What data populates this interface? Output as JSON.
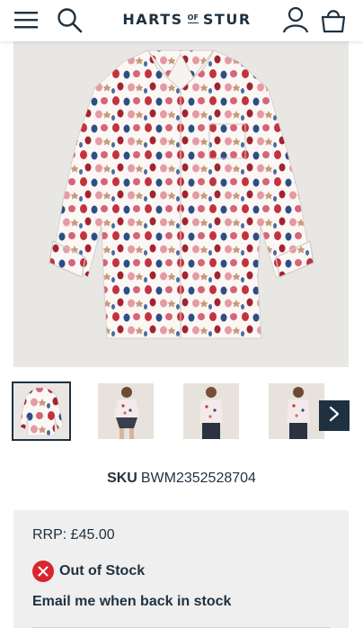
{
  "header": {
    "brand_left": "HARTS",
    "brand_of": "OF",
    "brand_right": "STUR",
    "icons": [
      "menu-icon",
      "search-icon",
      "account-icon",
      "basket-icon"
    ]
  },
  "product": {
    "sku_label": "SKU",
    "sku_value": "BWM2352528704",
    "thumbnails": [
      {
        "name": "thumb-shirt-flat",
        "selected": true
      },
      {
        "name": "thumb-model-seated",
        "selected": false
      },
      {
        "name": "thumb-model-front",
        "selected": false
      },
      {
        "name": "thumb-model-side",
        "selected": false
      }
    ]
  },
  "stock": {
    "rrp": "RRP: £45.00",
    "status": "Out of Stock",
    "email_cta": "Email me when back in stock"
  },
  "colors": {
    "brand_navy": "#1f3140",
    "oos_red": "#d8262f",
    "panel_grey": "#efefef"
  }
}
